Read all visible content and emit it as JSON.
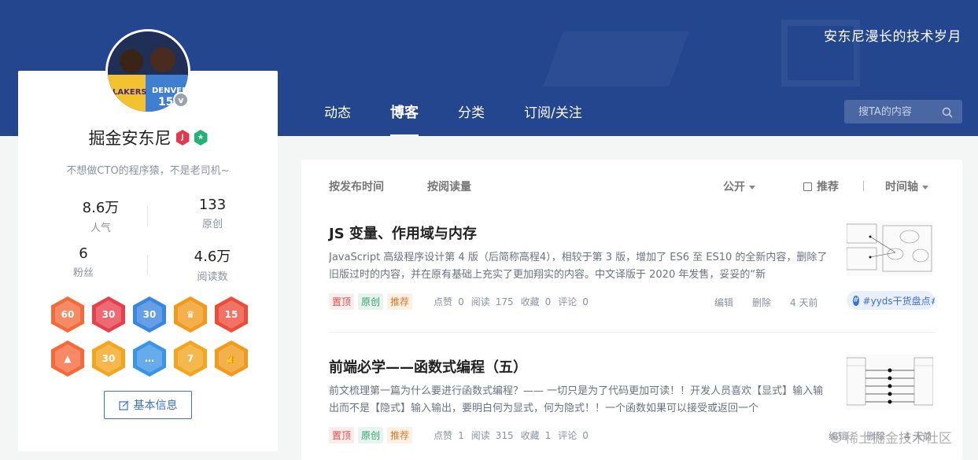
{
  "banner": {
    "slogan": "安东尼漫长的技术岁月"
  },
  "nav": {
    "tabs": [
      "动态",
      "博客",
      "分类",
      "订阅/关注"
    ],
    "active_index": 1
  },
  "search": {
    "placeholder": "搜TA的内容"
  },
  "profile": {
    "name": "掘金安东尼",
    "bio": "不想做CTO的程序猿，不是老司机~",
    "verified_mark": "v",
    "stats": [
      {
        "value": "8.6万",
        "label": "人气"
      },
      {
        "value": "133",
        "label": "原创"
      },
      {
        "value": "6",
        "label": "粉丝"
      },
      {
        "value": "4.6万",
        "label": "阅读数"
      }
    ],
    "medals": [
      {
        "text": "60",
        "color": "#f26b3a"
      },
      {
        "text": "30",
        "color": "#e6404c"
      },
      {
        "text": "30",
        "color": "#3a86e0"
      },
      {
        "text": "♛",
        "color": "#f39a1d"
      },
      {
        "text": "15",
        "color": "#ee4c3a"
      },
      {
        "text": "▲",
        "color": "#f5693a"
      },
      {
        "text": "30",
        "color": "#f2a51d"
      },
      {
        "text": "…",
        "color": "#3b95e6"
      },
      {
        "text": "7",
        "color": "#f2a51d"
      },
      {
        "text": "👍",
        "color": "#f39a1d"
      }
    ],
    "info_button": "基本信息"
  },
  "sort_bar": {
    "by_time": "按发布时间",
    "by_reads": "按阅读量",
    "visibility": "公开",
    "recommend": "推荐",
    "timeline": "时间轴"
  },
  "articles": [
    {
      "title": "JS 变量、作用域与内存",
      "summary": "JavaScript 高级程序设计第 4 版（后简称高程4），相较于第 3 版，增加了 ES6 至 ES10 的全新内容，删除了旧版过时的内容，并在原有基础上充实了更加翔实的内容。中文译版于 2020 年发售，妥妥的“新",
      "tags": [
        "置顶",
        "原创",
        "推荐"
      ],
      "likes_label": "点赞",
      "likes": "0",
      "reads_label": "阅读",
      "reads": "175",
      "favs_label": "收藏",
      "favs": "0",
      "comments_label": "评论",
      "comments": "0",
      "edit": "编辑",
      "delete": "删除",
      "time": "4 天前",
      "topic": "#yyds干货盘点#"
    },
    {
      "title": "前端必学——函数式编程（五）",
      "summary": "前文梳理第一篇为什么要进行函数式编程？—— 一切只是为了代码更加可读！！开发人员喜欢【显式】输入输出而不是【隐式】输入输出，要明白何为显式，何为隐式！！一个函数如果可以接受或返回一个",
      "tags": [
        "置顶",
        "原创",
        "推荐"
      ],
      "likes_label": "点赞",
      "likes": "1",
      "reads_label": "阅读",
      "reads": "315",
      "favs_label": "收藏",
      "favs": "1",
      "comments_label": "评论",
      "comments": "0",
      "edit": "编辑",
      "delete": "删除",
      "time": "4 天前"
    }
  ],
  "watermark": "稀土掘金技术社区"
}
